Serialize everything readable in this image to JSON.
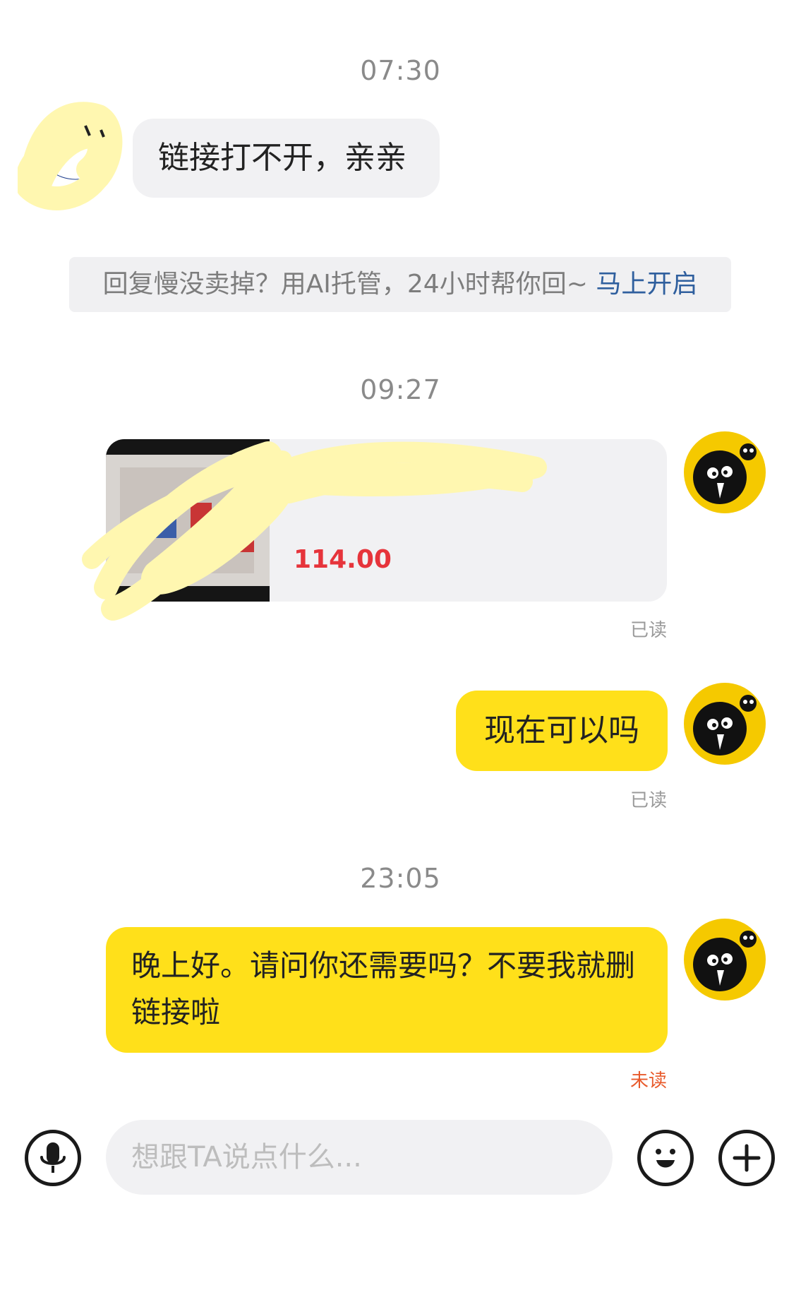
{
  "messages": {
    "time_1": "07:30",
    "incoming_text": "链接打不开，亲亲",
    "banner_text": "回复慢没卖掉？用AI托管，24小时帮你回~",
    "banner_link": "马上开启",
    "time_2": "09:27",
    "product_price": "114.00",
    "status_read_1": "已读",
    "outgoing_1": "现在可以吗",
    "status_read_2": "已读",
    "time_3": "23:05",
    "outgoing_2": "晚上好。请问你还需要吗？不要我就删链接啦",
    "status_unread": "未读"
  },
  "input_bar": {
    "placeholder": "想跟TA说点什么...",
    "voice_icon": "microphone-icon",
    "emoji_icon": "smiley-face-icon",
    "plus_icon": "plus-icon"
  },
  "colors": {
    "accent_yellow": "#ffe01a",
    "price_red": "#e6343b",
    "link_blue": "#2f5f9e",
    "unread_orange": "#e85a2b",
    "bubble_gray": "#f1f1f3"
  }
}
